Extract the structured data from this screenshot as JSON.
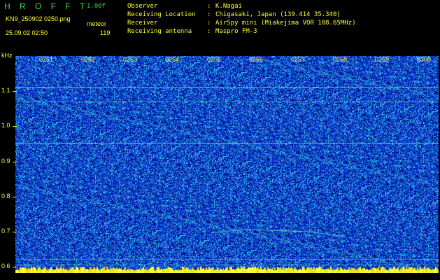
{
  "header": {
    "app_title": "H R O F F T",
    "version": "1.00f",
    "filename": "KN9_250902 0250.png",
    "meteor_label": "meteor",
    "datetime": "25.09.02 02:50",
    "meteor_count": "119"
  },
  "meta": [
    {
      "label": "Observer",
      "value": "K.Nagai"
    },
    {
      "label": "Receiving Location",
      "value": "Chigasaki, Japan (139.414 35.340)"
    },
    {
      "label": "Receiver",
      "value": "AirSpy mini (Miakejima VOR 108.65MHz)"
    },
    {
      "label": "Receiving antenna",
      "value": "Maspro FM-3"
    }
  ],
  "spectrogram": {
    "y_unit": "kHz",
    "y_ticks": [
      "1.1",
      "1.0",
      "0.9",
      "0.8",
      "0.7",
      "0.6"
    ],
    "time_ticks": [
      "0251",
      "0252",
      "0253",
      "0254",
      "0255",
      "0256",
      "0257",
      "0258",
      "0259",
      "0300"
    ],
    "colors": {
      "background": "#000000",
      "noise_low": "#000a8c",
      "noise_mid": "#1a4fe6",
      "noise_high": "#33c8f0",
      "label": "#ffff33",
      "title": "#3ed83e"
    }
  }
}
